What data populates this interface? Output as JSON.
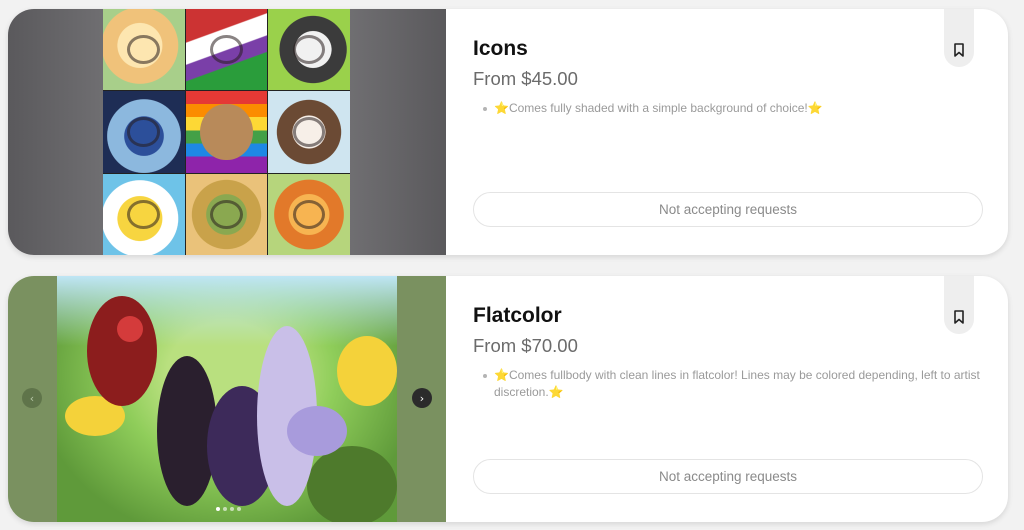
{
  "cards": [
    {
      "title": "Icons",
      "price": "From $45.00",
      "description": [
        "⭐Comes fully shaded with a simple background of choice!⭐"
      ],
      "request_button_label": "Not accepting requests",
      "bookmark_icon": "bookmark-icon"
    },
    {
      "title": "Flatcolor",
      "price": "From $70.00",
      "description": [
        "⭐Comes fullbody with clean lines in flatcolor! Lines may be colored depending, left to artist discretion.⭐"
      ],
      "request_button_label": "Not accepting requests",
      "bookmark_icon": "bookmark-icon",
      "carousel": {
        "prev_icon": "‹",
        "next_icon": "›",
        "slide_count": 4,
        "active_slide": 1
      }
    }
  ],
  "colors": {
    "page_bg": "#f2f2f2",
    "card_bg": "#ffffff",
    "title": "#111111",
    "price": "#6b6b6b",
    "muted_text": "#9a9a9a",
    "star": "#f2c94c"
  }
}
